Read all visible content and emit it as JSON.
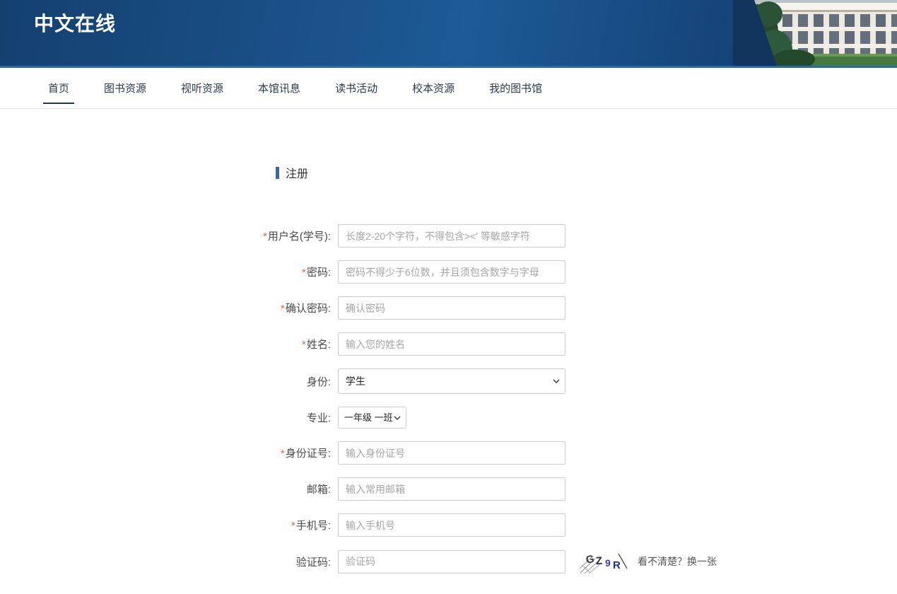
{
  "header": {
    "logo": "中文在线"
  },
  "nav": {
    "items": [
      {
        "id": "home",
        "label": "首页",
        "active": true
      },
      {
        "id": "book-resources",
        "label": "图书资源",
        "active": false
      },
      {
        "id": "av-resources",
        "label": "视听资源",
        "active": false
      },
      {
        "id": "library-news",
        "label": "本馆讯息",
        "active": false
      },
      {
        "id": "reading-activities",
        "label": "读书活动",
        "active": false
      },
      {
        "id": "school-resources",
        "label": "校本资源",
        "active": false
      },
      {
        "id": "my-library",
        "label": "我的图书馆",
        "active": false
      }
    ]
  },
  "form": {
    "title": "注册",
    "required_marker": "*",
    "fields": [
      {
        "id": "username",
        "label": "用户名(学号):",
        "required": true,
        "control": "input",
        "placeholder": "长度2-20个字符，不得包含><' 等敏感字符",
        "value": ""
      },
      {
        "id": "password",
        "label": "密码:",
        "required": true,
        "control": "input",
        "placeholder": "密码不得少于6位数，并且须包含数字与字母",
        "value": ""
      },
      {
        "id": "confirm-password",
        "label": "确认密码:",
        "required": true,
        "control": "input",
        "placeholder": "确认密码",
        "value": ""
      },
      {
        "id": "name",
        "label": "姓名:",
        "required": true,
        "control": "input",
        "placeholder": "输入您的姓名",
        "value": ""
      },
      {
        "id": "identity",
        "label": "身份:",
        "required": false,
        "control": "select",
        "value": "学生",
        "size": "full"
      },
      {
        "id": "major",
        "label": "专业:",
        "required": false,
        "control": "select",
        "value": "一年级 一班",
        "size": "narrow"
      },
      {
        "id": "id-number",
        "label": "身份证号:",
        "required": true,
        "control": "input",
        "placeholder": "输入身份证号",
        "value": ""
      },
      {
        "id": "email",
        "label": "邮箱:",
        "required": false,
        "control": "input",
        "placeholder": "输入常用邮箱",
        "value": ""
      },
      {
        "id": "phone",
        "label": "手机号:",
        "required": true,
        "control": "input",
        "placeholder": "输入手机号",
        "value": ""
      },
      {
        "id": "captcha",
        "label": "验证码:",
        "required": false,
        "control": "input",
        "placeholder": "验证码",
        "value": "",
        "captcha": true
      }
    ],
    "captcha": {
      "code": "GZ9R",
      "char_colors": [
        "#3a3a3a",
        "#2b2b2b",
        "#2f3fd0",
        "#1c2d8a"
      ],
      "refresh_label": "看不清楚？换一张"
    }
  },
  "colors": {
    "header_gradient_start": "#14406f",
    "header_gradient_mid": "#1d5a96",
    "header_gradient_end": "#0f3463",
    "header_border": "#2a6aa5",
    "nav_text": "#2c3a4d",
    "nav_active_underline": "#22384f",
    "section_bar": "#3c66a4",
    "required_asterisk": "#e0694b",
    "input_border": "#cccccc",
    "placeholder_text": "#a6a6a6"
  }
}
